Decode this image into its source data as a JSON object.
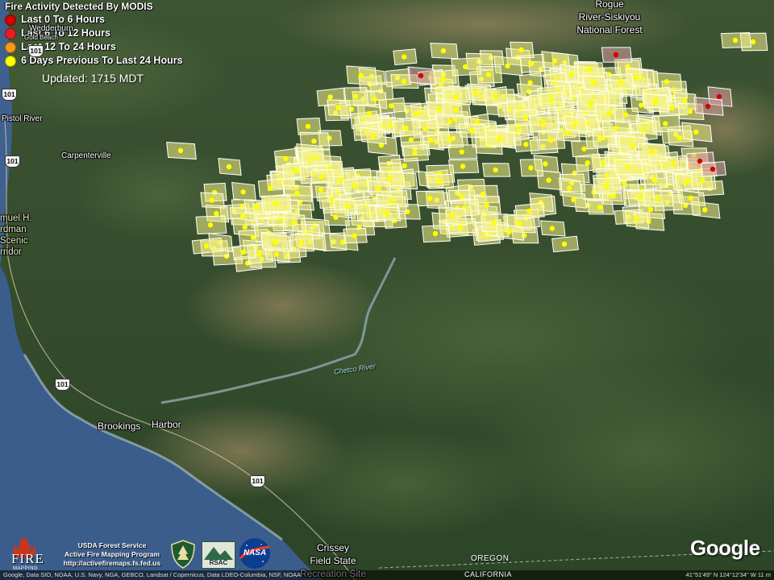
{
  "legend": {
    "title": "Fire Activity Detected By MODIS",
    "items": [
      {
        "label": "Last 0 To 6 Hours",
        "color": "#d40000"
      },
      {
        "label": "Last 6 To 12 Hours",
        "color": "#e52020"
      },
      {
        "label": "Last 12 To 24 Hours",
        "color": "#f39a1a"
      },
      {
        "label": "6 Days Previous To Last 24 Hours",
        "color": "#ffff00"
      }
    ],
    "updated": "Updated: 1715 MDT"
  },
  "places": {
    "wedderburn": "Wedderburn",
    "gold_beach": "Gold Beach",
    "pistol_river": "Pistol River",
    "carpenterville": "Carpenterville",
    "samuel_line1": "muel H.",
    "samuel_line2": "rdman",
    "samuel_line3": "Scenic",
    "samuel_line4": "rridor",
    "brookings": "Brookings",
    "harbor": "Harbor",
    "forest_line1": "Rogue",
    "forest_line2": "River-Siskiyou",
    "forest_line3": "National Forest",
    "crissey_line1": "Crissey",
    "crissey_line2": "Field State",
    "crissey_line3": "Recreation Site",
    "chetco_river": "Chetco River",
    "oregon": "OREGON",
    "california": "CALIFORNIA"
  },
  "highways": {
    "h1": "101",
    "h2": "101",
    "h3": "101",
    "h4": "101",
    "h5": "101"
  },
  "footer": {
    "fire_word": "FIRE",
    "fire_sub": "MAPPING",
    "usda_line1": "USDA Forest Service",
    "usda_line2": "Active Fire Mapping Program",
    "usda_line3": "http://activefiremaps.fs.fed.us",
    "rsac": "RSAC",
    "nasa": "NASA",
    "google": "Google",
    "attribution": "Google, Data SIO, NOAA, U.S. Navy, NGA, GEBCO, Landsat / Copernicus, Data LDEO-Columbia, NSF, NOAA",
    "coords": "41°51'49\" N 124°12'34\" W 11 m"
  },
  "colors": {
    "detection_fill": "#f3f089",
    "detection_stroke": "#ffffff",
    "detection_dot": "#ffff00",
    "recent_fill": "#d9a0a0",
    "recent_dot": "#d40000",
    "ocean": "#3b5d8c",
    "forest": "#2f4a2a"
  }
}
